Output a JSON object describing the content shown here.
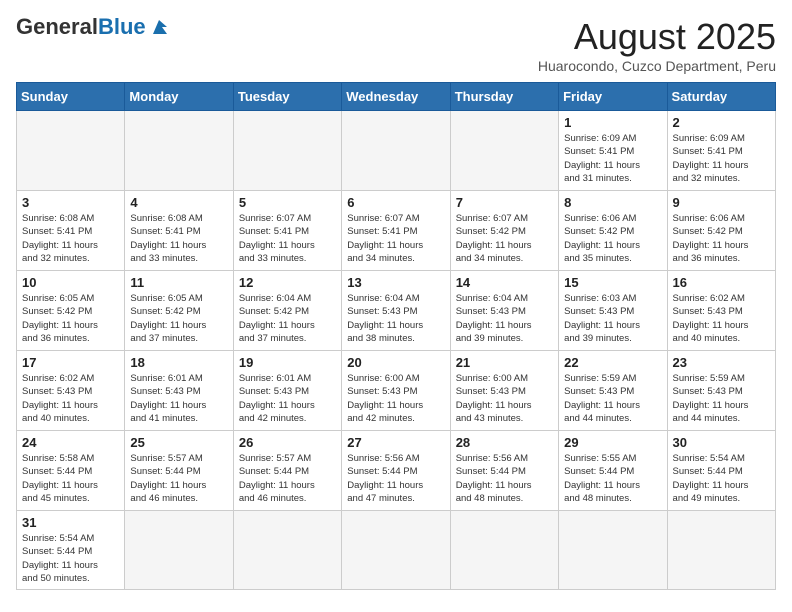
{
  "header": {
    "logo_general": "General",
    "logo_blue": "Blue",
    "month_title": "August 2025",
    "subtitle": "Huarocondo, Cuzco Department, Peru"
  },
  "days_of_week": [
    "Sunday",
    "Monday",
    "Tuesday",
    "Wednesday",
    "Thursday",
    "Friday",
    "Saturday"
  ],
  "weeks": [
    [
      {
        "day": "",
        "info": ""
      },
      {
        "day": "",
        "info": ""
      },
      {
        "day": "",
        "info": ""
      },
      {
        "day": "",
        "info": ""
      },
      {
        "day": "",
        "info": ""
      },
      {
        "day": "1",
        "info": "Sunrise: 6:09 AM\nSunset: 5:41 PM\nDaylight: 11 hours\nand 31 minutes."
      },
      {
        "day": "2",
        "info": "Sunrise: 6:09 AM\nSunset: 5:41 PM\nDaylight: 11 hours\nand 32 minutes."
      }
    ],
    [
      {
        "day": "3",
        "info": "Sunrise: 6:08 AM\nSunset: 5:41 PM\nDaylight: 11 hours\nand 32 minutes."
      },
      {
        "day": "4",
        "info": "Sunrise: 6:08 AM\nSunset: 5:41 PM\nDaylight: 11 hours\nand 33 minutes."
      },
      {
        "day": "5",
        "info": "Sunrise: 6:07 AM\nSunset: 5:41 PM\nDaylight: 11 hours\nand 33 minutes."
      },
      {
        "day": "6",
        "info": "Sunrise: 6:07 AM\nSunset: 5:41 PM\nDaylight: 11 hours\nand 34 minutes."
      },
      {
        "day": "7",
        "info": "Sunrise: 6:07 AM\nSunset: 5:42 PM\nDaylight: 11 hours\nand 34 minutes."
      },
      {
        "day": "8",
        "info": "Sunrise: 6:06 AM\nSunset: 5:42 PM\nDaylight: 11 hours\nand 35 minutes."
      },
      {
        "day": "9",
        "info": "Sunrise: 6:06 AM\nSunset: 5:42 PM\nDaylight: 11 hours\nand 36 minutes."
      }
    ],
    [
      {
        "day": "10",
        "info": "Sunrise: 6:05 AM\nSunset: 5:42 PM\nDaylight: 11 hours\nand 36 minutes."
      },
      {
        "day": "11",
        "info": "Sunrise: 6:05 AM\nSunset: 5:42 PM\nDaylight: 11 hours\nand 37 minutes."
      },
      {
        "day": "12",
        "info": "Sunrise: 6:04 AM\nSunset: 5:42 PM\nDaylight: 11 hours\nand 37 minutes."
      },
      {
        "day": "13",
        "info": "Sunrise: 6:04 AM\nSunset: 5:43 PM\nDaylight: 11 hours\nand 38 minutes."
      },
      {
        "day": "14",
        "info": "Sunrise: 6:04 AM\nSunset: 5:43 PM\nDaylight: 11 hours\nand 39 minutes."
      },
      {
        "day": "15",
        "info": "Sunrise: 6:03 AM\nSunset: 5:43 PM\nDaylight: 11 hours\nand 39 minutes."
      },
      {
        "day": "16",
        "info": "Sunrise: 6:02 AM\nSunset: 5:43 PM\nDaylight: 11 hours\nand 40 minutes."
      }
    ],
    [
      {
        "day": "17",
        "info": "Sunrise: 6:02 AM\nSunset: 5:43 PM\nDaylight: 11 hours\nand 40 minutes."
      },
      {
        "day": "18",
        "info": "Sunrise: 6:01 AM\nSunset: 5:43 PM\nDaylight: 11 hours\nand 41 minutes."
      },
      {
        "day": "19",
        "info": "Sunrise: 6:01 AM\nSunset: 5:43 PM\nDaylight: 11 hours\nand 42 minutes."
      },
      {
        "day": "20",
        "info": "Sunrise: 6:00 AM\nSunset: 5:43 PM\nDaylight: 11 hours\nand 42 minutes."
      },
      {
        "day": "21",
        "info": "Sunrise: 6:00 AM\nSunset: 5:43 PM\nDaylight: 11 hours\nand 43 minutes."
      },
      {
        "day": "22",
        "info": "Sunrise: 5:59 AM\nSunset: 5:43 PM\nDaylight: 11 hours\nand 44 minutes."
      },
      {
        "day": "23",
        "info": "Sunrise: 5:59 AM\nSunset: 5:43 PM\nDaylight: 11 hours\nand 44 minutes."
      }
    ],
    [
      {
        "day": "24",
        "info": "Sunrise: 5:58 AM\nSunset: 5:44 PM\nDaylight: 11 hours\nand 45 minutes."
      },
      {
        "day": "25",
        "info": "Sunrise: 5:57 AM\nSunset: 5:44 PM\nDaylight: 11 hours\nand 46 minutes."
      },
      {
        "day": "26",
        "info": "Sunrise: 5:57 AM\nSunset: 5:44 PM\nDaylight: 11 hours\nand 46 minutes."
      },
      {
        "day": "27",
        "info": "Sunrise: 5:56 AM\nSunset: 5:44 PM\nDaylight: 11 hours\nand 47 minutes."
      },
      {
        "day": "28",
        "info": "Sunrise: 5:56 AM\nSunset: 5:44 PM\nDaylight: 11 hours\nand 48 minutes."
      },
      {
        "day": "29",
        "info": "Sunrise: 5:55 AM\nSunset: 5:44 PM\nDaylight: 11 hours\nand 48 minutes."
      },
      {
        "day": "30",
        "info": "Sunrise: 5:54 AM\nSunset: 5:44 PM\nDaylight: 11 hours\nand 49 minutes."
      }
    ],
    [
      {
        "day": "31",
        "info": "Sunrise: 5:54 AM\nSunset: 5:44 PM\nDaylight: 11 hours\nand 50 minutes."
      },
      {
        "day": "",
        "info": ""
      },
      {
        "day": "",
        "info": ""
      },
      {
        "day": "",
        "info": ""
      },
      {
        "day": "",
        "info": ""
      },
      {
        "day": "",
        "info": ""
      },
      {
        "day": "",
        "info": ""
      }
    ]
  ]
}
